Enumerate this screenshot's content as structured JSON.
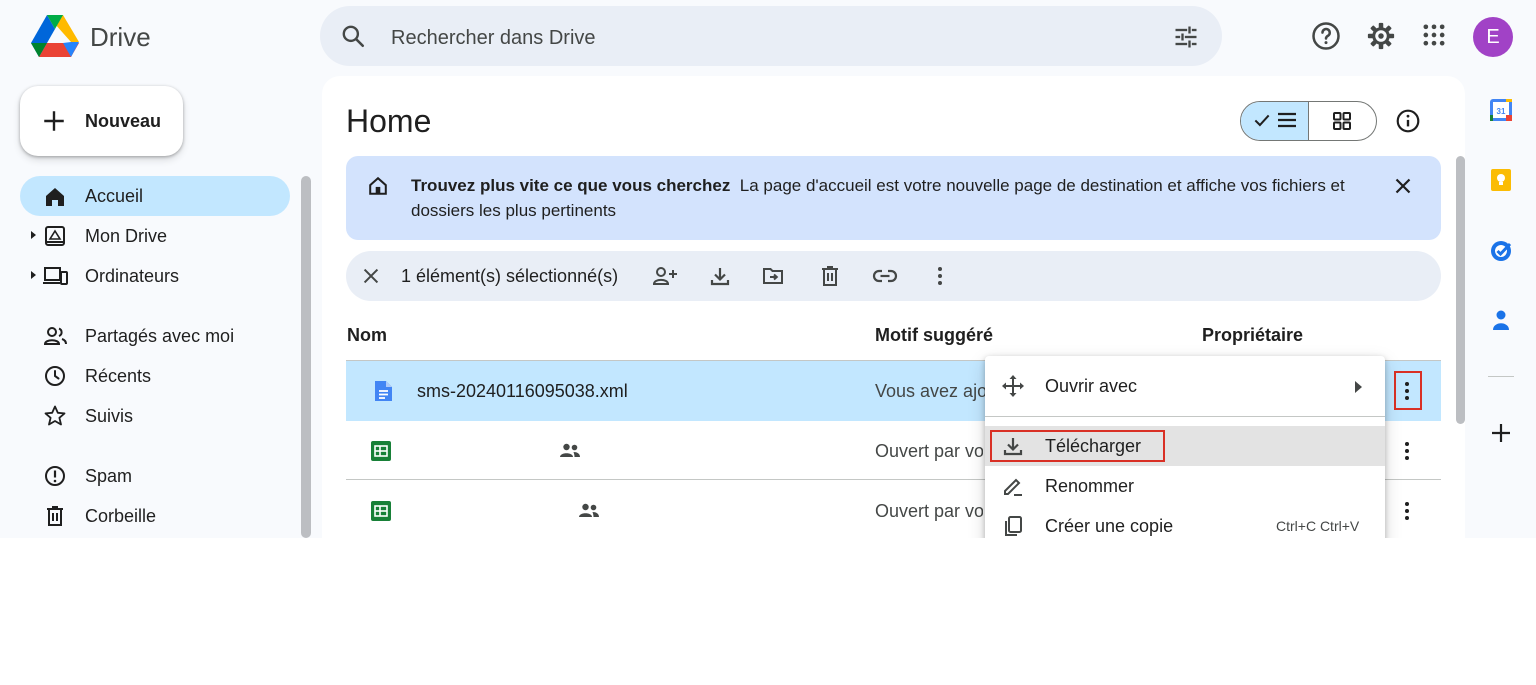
{
  "header": {
    "brand": "Drive",
    "search_placeholder": "Rechercher dans Drive",
    "avatar_letter": "E"
  },
  "sidebar": {
    "new_label": "Nouveau",
    "items": [
      {
        "label": "Accueil",
        "active": true
      },
      {
        "label": "Mon Drive"
      },
      {
        "label": "Ordinateurs"
      },
      {
        "label": "Partagés avec moi"
      },
      {
        "label": "Récents"
      },
      {
        "label": "Suivis"
      },
      {
        "label": "Spam"
      },
      {
        "label": "Corbeille"
      }
    ]
  },
  "main": {
    "title": "Home",
    "banner": {
      "title": "Trouvez plus vite ce que vous cherchez",
      "text": "La page d'accueil est votre nouvelle page de destination et affiche vos fichiers et dossiers les plus pertinents"
    },
    "selection": {
      "count_text": "1 élément(s) sélectionné(s)"
    },
    "columns": [
      "Nom",
      "Motif suggéré",
      "Propriétaire"
    ],
    "rows": [
      {
        "name": "sms-20240116095038.xml",
        "reason": "Vous avez ajouté",
        "selected": true
      },
      {
        "name": "",
        "reason": "Ouvert par vous"
      },
      {
        "name": "",
        "reason": "Ouvert par vous"
      }
    ]
  },
  "context_menu": {
    "items": [
      {
        "label": "Ouvrir avec"
      },
      {
        "label": "Télécharger",
        "hovered": true
      },
      {
        "label": "Renommer"
      },
      {
        "label": "Créer une copie",
        "shortcut": "Ctrl+C Ctrl+V"
      }
    ]
  },
  "colors": {
    "accent": "#0b57d0",
    "selected_row": "#c2e7ff",
    "banner": "#d3e3fd",
    "highlight": "#d93025"
  }
}
